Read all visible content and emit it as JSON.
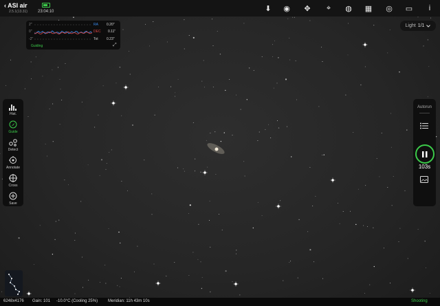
{
  "app": {
    "brand": "ASI air",
    "version": "2.5.1(13.31)",
    "time": "23:04:10"
  },
  "topbar_icons": [
    {
      "name": "download-icon",
      "glyph": "⬇"
    },
    {
      "name": "camera-icon",
      "glyph": "◉"
    },
    {
      "name": "mount-icon",
      "glyph": "✥"
    },
    {
      "name": "telescope-icon",
      "glyph": "⌖"
    },
    {
      "name": "filter-wheel-icon",
      "glyph": "◍"
    },
    {
      "name": "ek-plan-icon",
      "glyph": "▦"
    },
    {
      "name": "guide-camera-icon",
      "glyph": "◎"
    },
    {
      "name": "storage-icon",
      "glyph": "▭"
    },
    {
      "name": "info-icon",
      "glyph": "i"
    }
  ],
  "guide_graph": {
    "y_labels": [
      "2\"",
      "0\"",
      "-2\""
    ],
    "ra_label": "RA",
    "ra_value": "0.20\"",
    "dec_label": "DEC",
    "dec_value": "0.11\"",
    "tot_label": "Tot",
    "tot_value": "0.23\"",
    "status": "Guiding",
    "ra_color": "#3a8cf0",
    "dec_color": "#e04646"
  },
  "frame_selector": {
    "label": "Light",
    "value": "1/1"
  },
  "left_tools": [
    {
      "name": "hist-tool",
      "icon": "histogram-icon",
      "label": "Hist."
    },
    {
      "name": "guide-tool",
      "icon": "guide-icon",
      "label": "Guide",
      "active": true
    },
    {
      "name": "detect-tool",
      "icon": "detect-stars-icon",
      "label": "Detect"
    },
    {
      "name": "annotate-tool",
      "icon": "annotate-icon",
      "label": "Annotate"
    },
    {
      "name": "cross-tool",
      "icon": "crosshair-icon",
      "label": "Cross"
    },
    {
      "name": "save-tool",
      "icon": "save-plus-icon",
      "label": "Save"
    }
  ],
  "right_panel": {
    "autorun_label": "Autorun",
    "exposure": "103s"
  },
  "status_bar": {
    "resolution": "6248x4176",
    "gain": "Gain: 101",
    "temperature": "-10.0°C (Cooling 25%)",
    "meridian": "Meridian: 11h 43m 10s",
    "state": "Shooting"
  },
  "colors": {
    "accent": "#3ccb4a",
    "panel": "#0f0f0f",
    "sky": "#262626"
  }
}
